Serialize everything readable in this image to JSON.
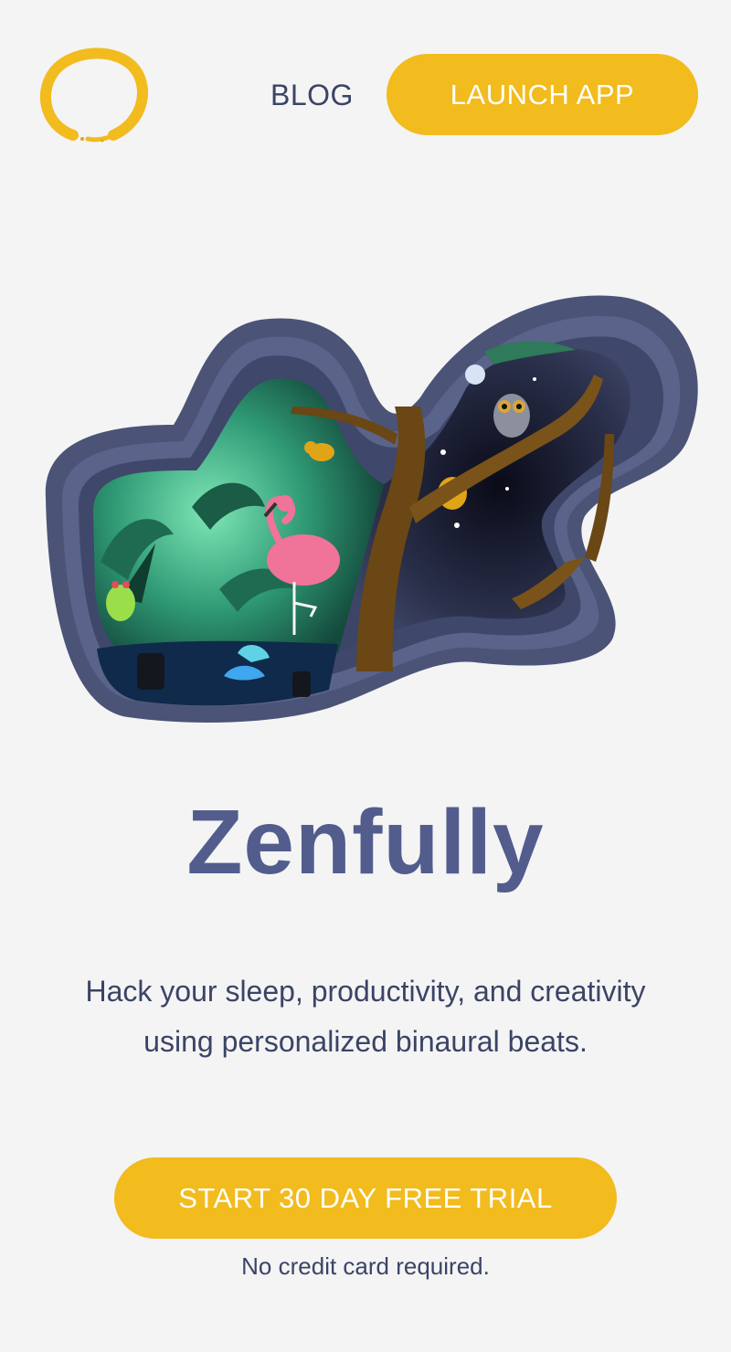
{
  "header": {
    "logo_icon": "enso-circle-icon",
    "blog_label": "BLOG",
    "launch_label": "LAUNCH APP"
  },
  "hero": {
    "illustration": "paper-cut-jungle-night-illustration",
    "title": "Zenfully",
    "tagline": "Hack your sleep, productivity, and creativity using personalized binaural beats."
  },
  "cta": {
    "trial_label": "START 30 DAY FREE TRIAL",
    "note": "No credit card required."
  },
  "colors": {
    "background": "#f4f4f4",
    "accent": "#f2bb1e",
    "title": "#525d8d",
    "text": "#3b4466",
    "frame": "#4b5377"
  }
}
